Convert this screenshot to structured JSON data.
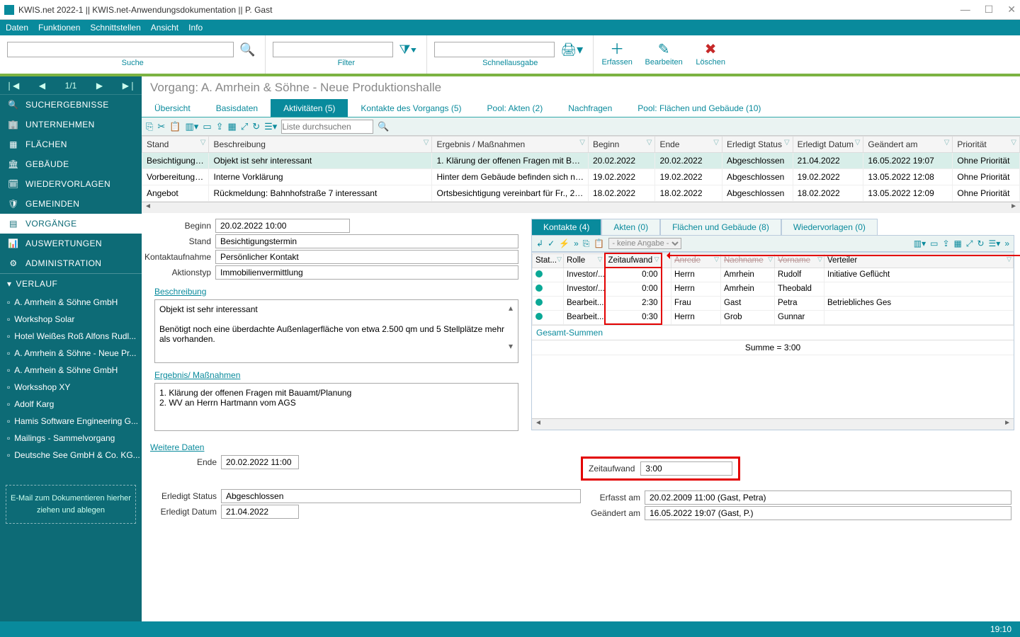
{
  "title": "KWIS.net 2022-1 || KWIS.net-Anwendungsdokumentation || P. Gast",
  "menu": [
    "Daten",
    "Funktionen",
    "Schnittstellen",
    "Ansicht",
    "Info"
  ],
  "toolbar": {
    "suche": "Suche",
    "filter": "Filter",
    "quick": "Schnellausgabe",
    "erfassen": "Erfassen",
    "bearbeiten": "Bearbeiten",
    "loeschen": "Löschen"
  },
  "left": {
    "pager": "1/1",
    "items": [
      {
        "label": "SUCHERGEBNISSE",
        "glyph": "🔍"
      },
      {
        "label": "UNTERNEHMEN",
        "glyph": "🏢"
      },
      {
        "label": "FLÄCHEN",
        "glyph": "▦"
      },
      {
        "label": "GEBÄUDE",
        "glyph": "🏛"
      },
      {
        "label": "WIEDERVORLAGEN",
        "glyph": "🗓"
      },
      {
        "label": "GEMEINDEN",
        "glyph": "🛡"
      },
      {
        "label": "VORGÄNGE",
        "glyph": "▤"
      },
      {
        "label": "AUSWERTUNGEN",
        "glyph": "📊"
      },
      {
        "label": "ADMINISTRATION",
        "glyph": "⚙"
      }
    ],
    "verlauf_head": "VERLAUF",
    "verlauf": [
      "A. Amrhein & Söhne GmbH",
      "Workshop Solar",
      "Hotel Weißes Roß Alfons Rudl...",
      "A. Amrhein & Söhne - Neue Pr...",
      "A. Amrhein & Söhne GmbH",
      "Worksshop XY",
      "Adolf Karg",
      "Hamis Software Engineering G...",
      "Mailings - Sammelvorgang",
      "Deutsche See GmbH & Co. KG..."
    ],
    "dropzone": "E-Mail  zum Dokumentieren hierher ziehen und ablegen"
  },
  "breadcrumb": "Vorgang: A. Amrhein & Söhne - Neue Produktionshalle",
  "tabs": [
    "Übersicht",
    "Basisdaten",
    "Aktivitäten (5)",
    "Kontakte des Vorgangs (5)",
    "Pool: Akten (2)",
    "Nachfragen",
    "Pool: Flächen und Gebäude (10)"
  ],
  "list_search_ph": "Liste durchsuchen",
  "grid": {
    "cols": [
      "Stand",
      "Beschreibung",
      "Ergebnis / Maßnahmen",
      "Beginn",
      "Ende",
      "Erledigt Status",
      "Erledigt Datum",
      "Geändert am",
      "Priorität"
    ],
    "rows": [
      {
        "stand": "Besichtigungst...",
        "be": "Objekt ist sehr interessant",
        "erg": "1. Klärung der offenen Fragen mit Baua...",
        "beg": "20.02.2022",
        "end": "20.02.2022",
        "st": "Abgeschlossen",
        "ed": "21.04.2022",
        "ge": "16.05.2022 19:07",
        "pr": "Ohne Priorität"
      },
      {
        "stand": "Vorbereitung  B...",
        "be": "Interne Vorklärung",
        "erg": "Hinter dem Gebäude befinden sich noc...",
        "beg": "19.02.2022",
        "end": "19.02.2022",
        "st": "Abgeschlossen",
        "ed": "19.02.2022",
        "ge": "13.05.2022 12:08",
        "pr": "Ohne Priorität"
      },
      {
        "stand": "Angebot",
        "be": "Rückmeldung: Bahnhofstraße 7 interessant",
        "erg": "Ortsbesichtigung vereinbart für Fr., 20.2.",
        "beg": "18.02.2022",
        "end": "18.02.2022",
        "st": "Abgeschlossen",
        "ed": "18.02.2022",
        "ge": "13.05.2022 12:09",
        "pr": "Ohne Priorität"
      }
    ]
  },
  "detail": {
    "beginn_l": "Beginn",
    "beginn": "20.02.2022 10:00",
    "stand_l": "Stand",
    "stand": "Besichtigungstermin",
    "kontakt_l": "Kontaktaufnahme",
    "kontakt": "Persönlicher Kontakt",
    "aktion_l": "Aktionstyp",
    "aktion": "Immobilienvermittlung",
    "beschr_h": "Beschreibung",
    "beschr": "Objekt ist sehr interessant\n\nBenötigt noch eine überdachte Außenlagerfläche von etwa 2.500 qm und 5 Stellplätze mehr als vorhanden.",
    "erg_h": "Ergebnis/ Maßnahmen",
    "erg": "1. Klärung der offenen Fragen mit Bauamt/Planung\n2. WV an Herrn Hartmann vom AGS"
  },
  "subtabs": [
    "Kontakte (4)",
    "Akten (0)",
    "Flächen und Gebäude (8)",
    "Wiedervorlagen (0)"
  ],
  "sub_combo": "- keine Angabe -",
  "kgrid": {
    "cols": [
      "Stat...",
      "Rolle",
      "Zeitaufwand",
      "",
      "Anrede",
      "Nachname",
      "Vorname",
      "Verteiler"
    ],
    "rows": [
      {
        "rolle": "Investor/...",
        "z": "0:00",
        "an": "Herrn",
        "nn": "Amrhein",
        "vn": "Rudolf",
        "vt": "Initiative Geflücht"
      },
      {
        "rolle": "Investor/...",
        "z": "0:00",
        "an": "Herrn",
        "nn": "Amrhein",
        "vn": "Theobald",
        "vt": ""
      },
      {
        "rolle": "Bearbeit...",
        "z": "2:30",
        "an": "Frau",
        "nn": "Gast",
        "vn": "Petra",
        "vt": "Betriebliches  Ges"
      },
      {
        "rolle": "Bearbeit...",
        "z": "0:30",
        "an": "Herrn",
        "nn": "Grob",
        "vn": "Gunnar",
        "vt": ""
      }
    ],
    "sum_l": "Gesamt-Summen",
    "sum": "Summe = 3:00"
  },
  "weitere": {
    "head": "Weitere Daten",
    "ende_l": "Ende",
    "ende": "20.02.2022 11:00",
    "erl_st_l": "Erledigt Status",
    "erl_st": "Abgeschlossen",
    "erl_dt_l": "Erledigt Datum",
    "erl_dt": "21.04.2022",
    "zeit_l": "Zeitaufwand",
    "zeit": "3:00",
    "erf_l": "Erfasst am",
    "erf": "20.02.2009 11:00 (Gast, Petra)",
    "gea_l": "Geändert am",
    "gea": "16.05.2022 19:07 (Gast, P.)"
  },
  "status_time": "19:10"
}
